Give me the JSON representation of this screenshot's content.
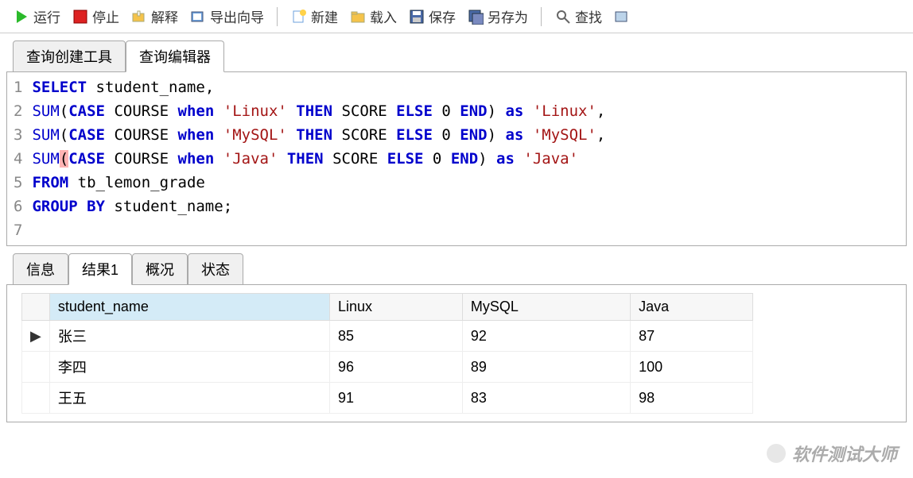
{
  "toolbar": {
    "run": "运行",
    "stop": "停止",
    "explain": "解释",
    "export_wizard": "导出向导",
    "new": "新建",
    "load": "载入",
    "save": "保存",
    "save_as": "另存为",
    "find": "查找"
  },
  "tabs_top": [
    {
      "label": "查询创建工具",
      "active": false
    },
    {
      "label": "查询编辑器",
      "active": true
    }
  ],
  "sql": {
    "lines": [
      {
        "tokens": [
          {
            "t": "kw",
            "v": "SELECT"
          },
          {
            "t": "sp",
            "v": " "
          },
          {
            "t": "ident",
            "v": "student_name,"
          }
        ]
      },
      {
        "tokens": [
          {
            "t": "fn",
            "v": "SUM"
          },
          {
            "t": "p",
            "v": "("
          },
          {
            "t": "kw",
            "v": "CASE"
          },
          {
            "t": "sp",
            "v": " "
          },
          {
            "t": "ident",
            "v": "COURSE "
          },
          {
            "t": "kw",
            "v": "when"
          },
          {
            "t": "sp",
            "v": " "
          },
          {
            "t": "str",
            "v": "'Linux'"
          },
          {
            "t": "sp",
            "v": " "
          },
          {
            "t": "kw",
            "v": "THEN"
          },
          {
            "t": "sp",
            "v": " "
          },
          {
            "t": "ident",
            "v": "SCORE "
          },
          {
            "t": "kw",
            "v": "ELSE"
          },
          {
            "t": "sp",
            "v": " "
          },
          {
            "t": "num",
            "v": "0 "
          },
          {
            "t": "kw",
            "v": "END"
          },
          {
            "t": "p",
            "v": ") "
          },
          {
            "t": "kw",
            "v": "as"
          },
          {
            "t": "sp",
            "v": " "
          },
          {
            "t": "str",
            "v": "'Linux'"
          },
          {
            "t": "p",
            "v": ","
          }
        ]
      },
      {
        "tokens": [
          {
            "t": "fn",
            "v": "SUM"
          },
          {
            "t": "p",
            "v": "("
          },
          {
            "t": "kw",
            "v": "CASE"
          },
          {
            "t": "sp",
            "v": " "
          },
          {
            "t": "ident",
            "v": "COURSE "
          },
          {
            "t": "kw",
            "v": "when"
          },
          {
            "t": "sp",
            "v": " "
          },
          {
            "t": "str",
            "v": "'MySQL'"
          },
          {
            "t": "sp",
            "v": " "
          },
          {
            "t": "kw",
            "v": "THEN"
          },
          {
            "t": "sp",
            "v": " "
          },
          {
            "t": "ident",
            "v": "SCORE "
          },
          {
            "t": "kw",
            "v": "ELSE"
          },
          {
            "t": "sp",
            "v": " "
          },
          {
            "t": "num",
            "v": "0 "
          },
          {
            "t": "kw",
            "v": "END"
          },
          {
            "t": "p",
            "v": ") "
          },
          {
            "t": "kw",
            "v": "as"
          },
          {
            "t": "sp",
            "v": " "
          },
          {
            "t": "str",
            "v": "'MySQL'"
          },
          {
            "t": "p",
            "v": ","
          }
        ]
      },
      {
        "tokens": [
          {
            "t": "fn",
            "v": "SUM"
          },
          {
            "t": "phl",
            "v": "("
          },
          {
            "t": "kw",
            "v": "CASE"
          },
          {
            "t": "sp",
            "v": " "
          },
          {
            "t": "ident",
            "v": "COURSE "
          },
          {
            "t": "kw",
            "v": "when"
          },
          {
            "t": "sp",
            "v": " "
          },
          {
            "t": "str",
            "v": "'Java'"
          },
          {
            "t": "sp",
            "v": " "
          },
          {
            "t": "kw",
            "v": "THEN"
          },
          {
            "t": "sp",
            "v": " "
          },
          {
            "t": "ident",
            "v": "SCORE "
          },
          {
            "t": "kw",
            "v": "ELSE"
          },
          {
            "t": "sp",
            "v": " "
          },
          {
            "t": "num",
            "v": "0 "
          },
          {
            "t": "kw",
            "v": "END"
          },
          {
            "t": "p",
            "v": ") "
          },
          {
            "t": "kw",
            "v": "as"
          },
          {
            "t": "sp",
            "v": " "
          },
          {
            "t": "str",
            "v": "'Java'"
          }
        ]
      },
      {
        "tokens": [
          {
            "t": "kw",
            "v": "FROM"
          },
          {
            "t": "sp",
            "v": " "
          },
          {
            "t": "ident",
            "v": "tb_lemon_grade"
          }
        ]
      },
      {
        "tokens": [
          {
            "t": "kw",
            "v": "GROUP BY"
          },
          {
            "t": "sp",
            "v": " "
          },
          {
            "t": "ident",
            "v": "student_name;"
          }
        ]
      },
      {
        "tokens": []
      }
    ]
  },
  "tabs_bottom": [
    {
      "label": "信息",
      "active": false
    },
    {
      "label": "结果1",
      "active": true
    },
    {
      "label": "概况",
      "active": false
    },
    {
      "label": "状态",
      "active": false
    }
  ],
  "result": {
    "columns": [
      "student_name",
      "Linux",
      "MySQL",
      "Java"
    ],
    "sorted_column": 0,
    "active_row": 0,
    "rows": [
      [
        "张三",
        "85",
        "92",
        "87"
      ],
      [
        "李四",
        "96",
        "89",
        "100"
      ],
      [
        "王五",
        "91",
        "83",
        "98"
      ]
    ]
  },
  "watermark": "软件测试大师"
}
